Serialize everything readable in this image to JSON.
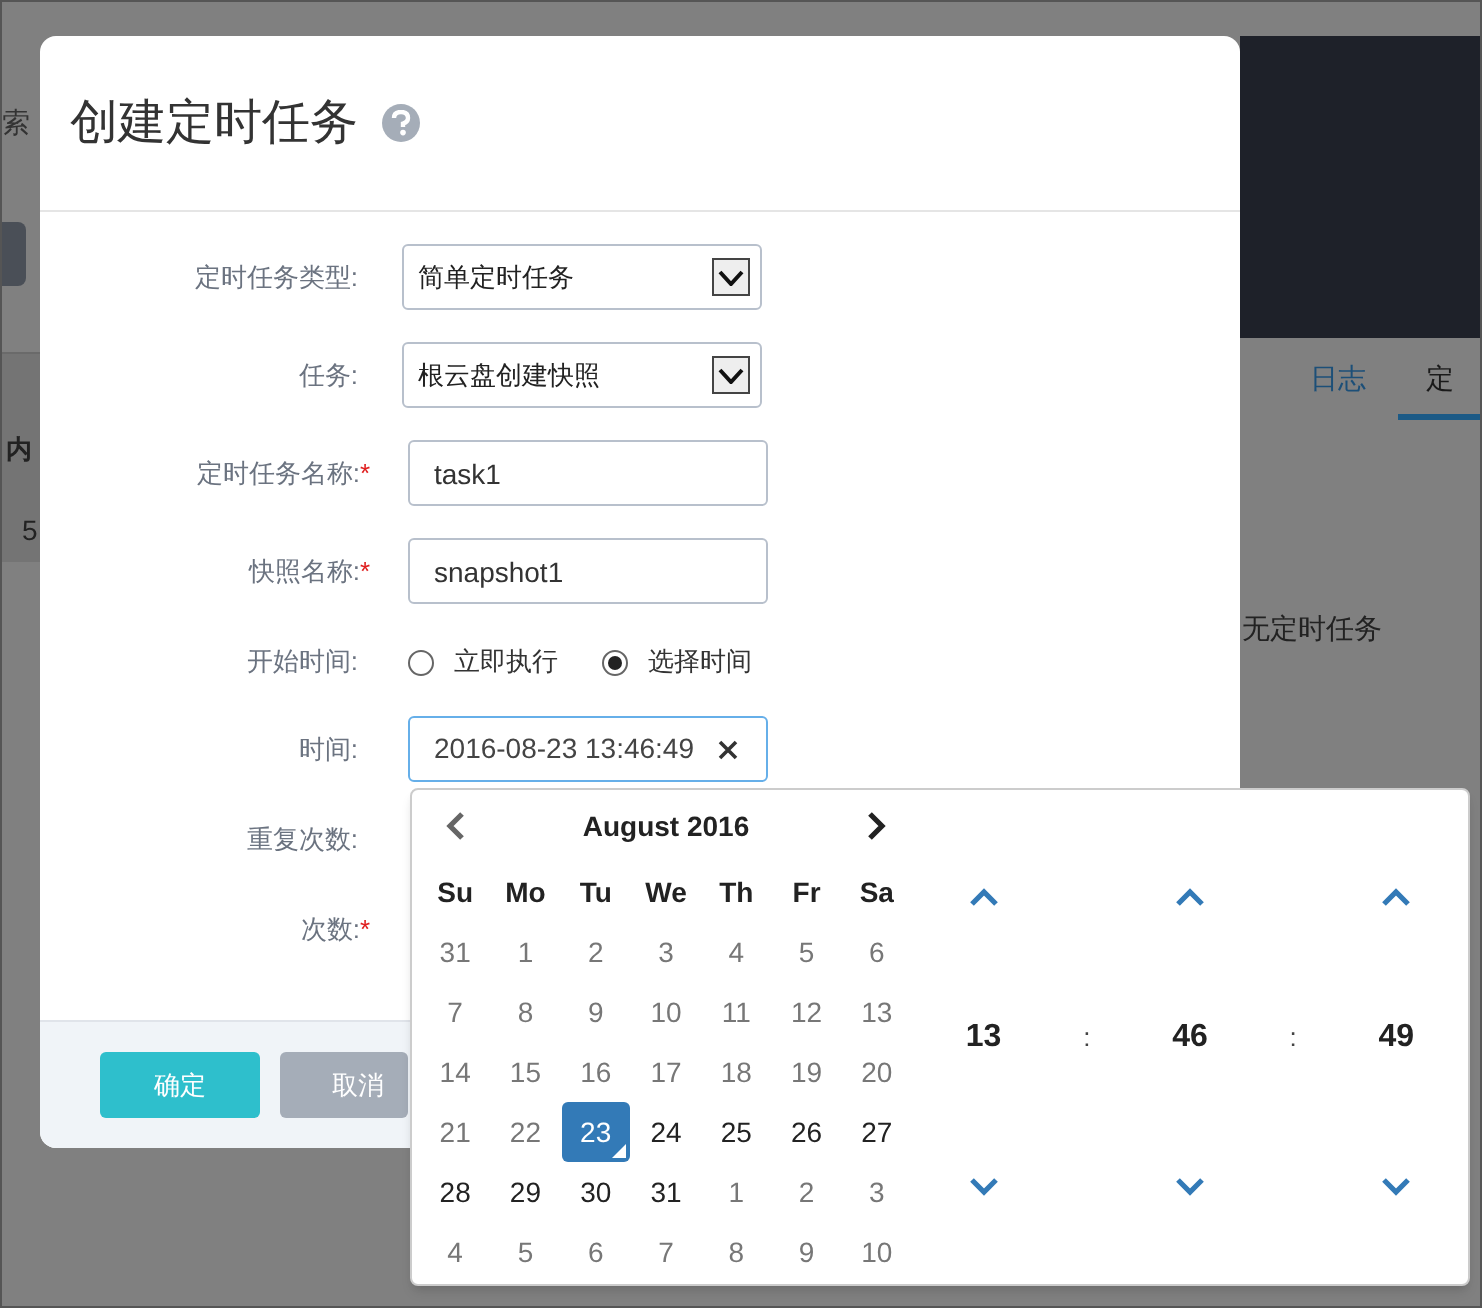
{
  "background": {
    "search_fragment": "索",
    "table_header_fragment": "内",
    "table_row_fragment": "5",
    "tabs": [
      {
        "label": "日志",
        "selected": false
      },
      {
        "label": "定",
        "selected": true
      }
    ],
    "empty_message": "无定时任务"
  },
  "dialog": {
    "title": "创建定时任务",
    "fields": [
      {
        "kind": "select",
        "label": "定时任务类型:",
        "value": "简单定时任务"
      },
      {
        "kind": "select",
        "label": "任务:",
        "value": "根云盘创建快照"
      },
      {
        "kind": "input",
        "label": "定时任务名称:",
        "required_mark": "*",
        "value": "task1"
      },
      {
        "kind": "input",
        "label": "快照名称:",
        "required_mark": "*",
        "value": "snapshot1"
      },
      {
        "kind": "radio",
        "label": "开始时间:",
        "options": [
          {
            "label": "立即执行",
            "selected": false
          },
          {
            "label": "选择时间",
            "selected": true
          }
        ]
      },
      {
        "kind": "datetime",
        "label": "时间:",
        "value": "2016-08-23 13:46:49"
      },
      {
        "kind": "covered",
        "label": "重复次数:"
      },
      {
        "kind": "covered",
        "label": "次数:",
        "required_mark": "*"
      }
    ],
    "buttons": [
      {
        "label": "确定",
        "kind": "primary"
      },
      {
        "label": "取消",
        "kind": "secondary"
      }
    ]
  },
  "picker": {
    "month": "August 2016",
    "weekdays": [
      "Su",
      "Mo",
      "Tu",
      "We",
      "Th",
      "Fr",
      "Sa"
    ],
    "weeks": [
      [
        {
          "day": "31",
          "muted": true,
          "selected": false
        },
        {
          "day": "1",
          "muted": true,
          "selected": false
        },
        {
          "day": "2",
          "muted": true,
          "selected": false
        },
        {
          "day": "3",
          "muted": true,
          "selected": false
        },
        {
          "day": "4",
          "muted": true,
          "selected": false
        },
        {
          "day": "5",
          "muted": true,
          "selected": false
        },
        {
          "day": "6",
          "muted": true,
          "selected": false
        }
      ],
      [
        {
          "day": "7",
          "muted": true,
          "selected": false
        },
        {
          "day": "8",
          "muted": true,
          "selected": false
        },
        {
          "day": "9",
          "muted": true,
          "selected": false
        },
        {
          "day": "10",
          "muted": true,
          "selected": false
        },
        {
          "day": "11",
          "muted": true,
          "selected": false
        },
        {
          "day": "12",
          "muted": true,
          "selected": false
        },
        {
          "day": "13",
          "muted": true,
          "selected": false
        }
      ],
      [
        {
          "day": "14",
          "muted": true,
          "selected": false
        },
        {
          "day": "15",
          "muted": true,
          "selected": false
        },
        {
          "day": "16",
          "muted": true,
          "selected": false
        },
        {
          "day": "17",
          "muted": true,
          "selected": false
        },
        {
          "day": "18",
          "muted": true,
          "selected": false
        },
        {
          "day": "19",
          "muted": true,
          "selected": false
        },
        {
          "day": "20",
          "muted": true,
          "selected": false
        }
      ],
      [
        {
          "day": "21",
          "muted": true,
          "selected": false
        },
        {
          "day": "22",
          "muted": true,
          "selected": false
        },
        {
          "day": "23",
          "muted": false,
          "selected": true
        },
        {
          "day": "24",
          "muted": false,
          "selected": false
        },
        {
          "day": "25",
          "muted": false,
          "selected": false
        },
        {
          "day": "26",
          "muted": false,
          "selected": false
        },
        {
          "day": "27",
          "muted": false,
          "selected": false
        }
      ],
      [
        {
          "day": "28",
          "muted": false,
          "selected": false
        },
        {
          "day": "29",
          "muted": false,
          "selected": false
        },
        {
          "day": "30",
          "muted": false,
          "selected": false
        },
        {
          "day": "31",
          "muted": false,
          "selected": false
        },
        {
          "day": "1",
          "muted": true,
          "selected": false
        },
        {
          "day": "2",
          "muted": true,
          "selected": false
        },
        {
          "day": "3",
          "muted": true,
          "selected": false
        }
      ],
      [
        {
          "day": "4",
          "muted": true,
          "selected": false
        },
        {
          "day": "5",
          "muted": true,
          "selected": false
        },
        {
          "day": "6",
          "muted": true,
          "selected": false
        },
        {
          "day": "7",
          "muted": true,
          "selected": false
        },
        {
          "day": "8",
          "muted": true,
          "selected": false
        },
        {
          "day": "9",
          "muted": true,
          "selected": false
        },
        {
          "day": "10",
          "muted": true,
          "selected": false
        }
      ]
    ],
    "time": {
      "hour": "13",
      "minute": "46",
      "second": "49",
      "separators": [
        ":",
        ":"
      ]
    }
  }
}
